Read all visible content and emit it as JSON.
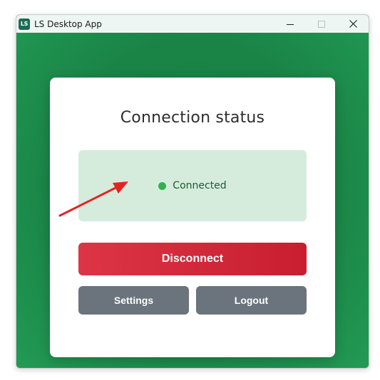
{
  "window": {
    "title": "LS Desktop App",
    "icon_text": "LS",
    "icon": "ls-app-icon",
    "controls": [
      "minimize-icon",
      "maximize-icon",
      "close-icon"
    ]
  },
  "card": {
    "title": "Connection status",
    "status": {
      "text": "Connected",
      "dot_color": "#2fb351",
      "background": "#d5ecdc"
    },
    "buttons": {
      "disconnect": "Disconnect",
      "settings": "Settings",
      "logout": "Logout"
    }
  },
  "colors": {
    "background_green": "#1a8446",
    "disconnect_red": "#dc3545",
    "secondary_gray": "#6b737c",
    "annotation_arrow": "#e52222"
  }
}
